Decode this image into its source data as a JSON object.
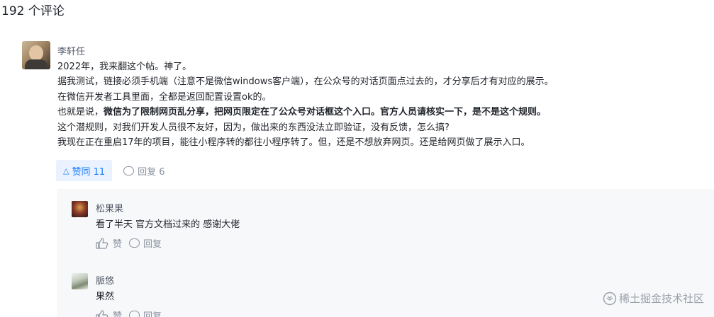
{
  "header": {
    "count_label": "192 个评论"
  },
  "comment": {
    "author": "李轩任",
    "lines": [
      {
        "text": "2022年，我来翻这个帖。神了。",
        "bold": false
      },
      {
        "text": "据我测试，链接必须手机端（注意不是微信windows客户端），在公众号的对话页面点过去的，才分享后才有对应的展示。",
        "bold": false
      },
      {
        "text": "在微信开发者工具里面，全都是返回配置设置ok的。",
        "bold": false
      },
      {
        "text_plain": "也就是说，",
        "text_bold": "微信为了限制网页乱分享，把网页限定在了公众号对话框这个入口。官方人员请核实一下，是不是这个规则。"
      },
      {
        "text": "这个潜规则，对我们开发人员很不友好，因为，做出来的东西没法立即验证，没有反馈，怎么搞?",
        "bold": false
      },
      {
        "text": "我现在正在重启17年的项目，能往小程序转的都往小程序转了。但，还是不想放弃网页。还是给网页做了展示入口。",
        "bold": false
      }
    ],
    "like_label": "赞同 11",
    "reply_label": "回复 6"
  },
  "replies": [
    {
      "author": "松果果",
      "text": "看了半天 官方文档过来的  感谢大佬",
      "like_label": "赞",
      "reply_label": "回复"
    },
    {
      "author": "脈悠",
      "text": "果然",
      "like_label": "赞",
      "reply_label": "回复"
    }
  ],
  "watermark": {
    "text": "稀土掘金技术社区"
  },
  "colors": {
    "accent": "#1e80ff",
    "muted": "#8a919f",
    "reply_bg": "#f7f8fa"
  }
}
